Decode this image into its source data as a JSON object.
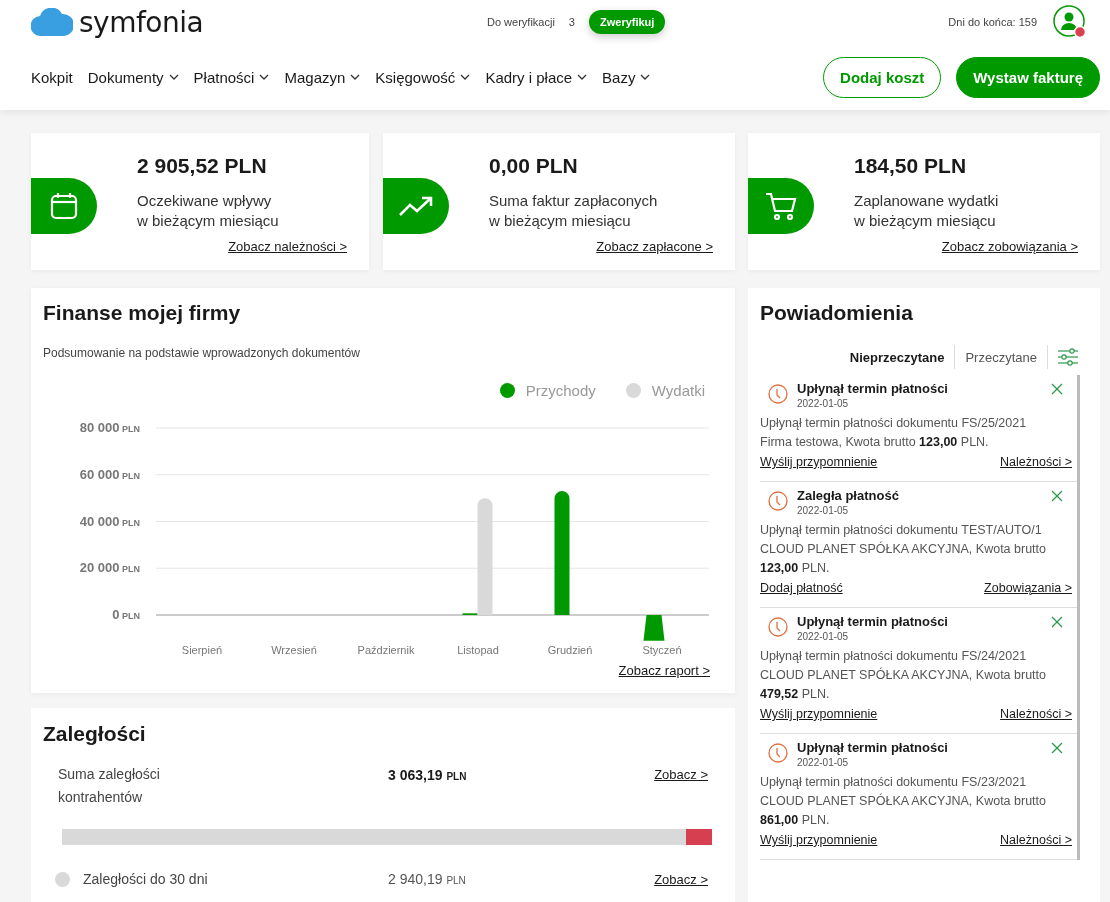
{
  "header": {
    "logo": "symfonia",
    "verify_label": "Do weryfikacji",
    "verify_count": "3",
    "verify_button": "Zweryfikuj",
    "days_left": "Dni do końca: 159"
  },
  "nav": [
    {
      "label": "Kokpit",
      "dropdown": false
    },
    {
      "label": "Dokumenty",
      "dropdown": true
    },
    {
      "label": "Płatności",
      "dropdown": true
    },
    {
      "label": "Magazyn",
      "dropdown": true
    },
    {
      "label": "Księgowość",
      "dropdown": true
    },
    {
      "label": "Kadry i płace",
      "dropdown": true
    },
    {
      "label": "Bazy",
      "dropdown": true
    }
  ],
  "actions": [
    {
      "label": "Dodaj koszt",
      "kind": "outline"
    },
    {
      "label": "Wystaw fakturę",
      "kind": "primary"
    }
  ],
  "summary_cards": [
    {
      "kind": "calendar",
      "amount": "2 905,52 PLN",
      "description": "Oczekiwane wpływy\nw bieżącym miesiącu",
      "link": "Zobacz należności >"
    },
    {
      "kind": "trend",
      "amount": "0,00 PLN",
      "description": "Suma faktur zapłaconych\nw bieżącym miesiącu",
      "link": "Zobacz zapłacone >"
    },
    {
      "kind": "cart",
      "amount": "184,50 PLN",
      "description": "Zaplanowane wydatki\nw bieżącym miesiącu",
      "link": "Zobacz zobowiązania >"
    }
  ],
  "finance": {
    "title": "Finanse mojej firmy",
    "subtitle": "Podsumowanie na podstawie wprowadzonych dokumentów",
    "link": "Zobacz raport >",
    "chart_data": {
      "type": "bar",
      "categories": [
        "Sierpień",
        "Wrzesień",
        "Październik",
        "Listopad",
        "Grudzień",
        "Styczeń"
      ],
      "series": [
        {
          "name": "Przychody",
          "color": "#009a00",
          "values": [
            0,
            0,
            0,
            300,
            53000,
            -11000
          ]
        },
        {
          "name": "Wydatki",
          "color": "#d9d9d9",
          "values": [
            0,
            0,
            0,
            50000,
            0,
            0
          ]
        }
      ],
      "ylim": [
        -11000,
        80000
      ],
      "grid": true,
      "yticks": [
        {
          "value": 0,
          "label": "0 PLN"
        },
        {
          "value": 20000,
          "label": "20 000 PLN"
        },
        {
          "value": 40000,
          "label": "40 000 PLN"
        },
        {
          "value": 60000,
          "label": "60 000 PLN"
        },
        {
          "value": 80000,
          "label": "80 000 PLN"
        }
      ]
    }
  },
  "overdue": {
    "title": "Zaległości",
    "total_label": "Suma zaległości\nkontrahentów",
    "total_amount": "3 063,19",
    "total_currency": "PLN",
    "total_link": "Zobacz >",
    "bar": {
      "level": 0.96
    },
    "items": [
      {
        "label": "Zaległości do 30 dni",
        "amount": "2 940,19",
        "currency": "PLN",
        "link": "Zobacz >",
        "color": "#d9d9d9"
      }
    ]
  },
  "notifications": {
    "title": "Powiadomienia",
    "tabs": [
      {
        "label": "Nieprzeczytane",
        "selected": true
      },
      {
        "label": "Przeczytane",
        "selected": false
      }
    ],
    "items": [
      {
        "title": "Upłynął termin płatności",
        "date": "2022-01-05",
        "body": "Upłynął termin płatności dokumentu FS/25/2021\nFirma testowa, Kwota brutto **123,00** PLN.",
        "action": "Wyślij przypomnienie",
        "link": "Należności >"
      },
      {
        "title": "Zaległa płatność",
        "date": "2022-01-05",
        "body": "Upłynął termin płatności dokumentu TEST/AUTO/1\nCLOUD PLANET SPÓŁKA AKCYJNA, Kwota brutto\n**123,00** PLN.",
        "action": "Dodaj płatność",
        "link": "Zobowiązania >"
      },
      {
        "title": "Upłynął termin płatności",
        "date": "2022-01-05",
        "body": "Upłynął termin płatności dokumentu FS/24/2021\nCLOUD PLANET SPÓŁKA AKCYJNA, Kwota brutto\n**479,52** PLN.",
        "action": "Wyślij przypomnienie",
        "link": "Należności >"
      },
      {
        "title": "Upłynął termin płatności",
        "date": "2022-01-05",
        "body": "Upłynął termin płatności dokumentu FS/23/2021\nCLOUD PLANET SPÓŁKA AKCYJNA, Kwota brutto\n**861,00** PLN.",
        "action": "Wyślij przypomnienie",
        "link": "Należności >"
      }
    ]
  }
}
